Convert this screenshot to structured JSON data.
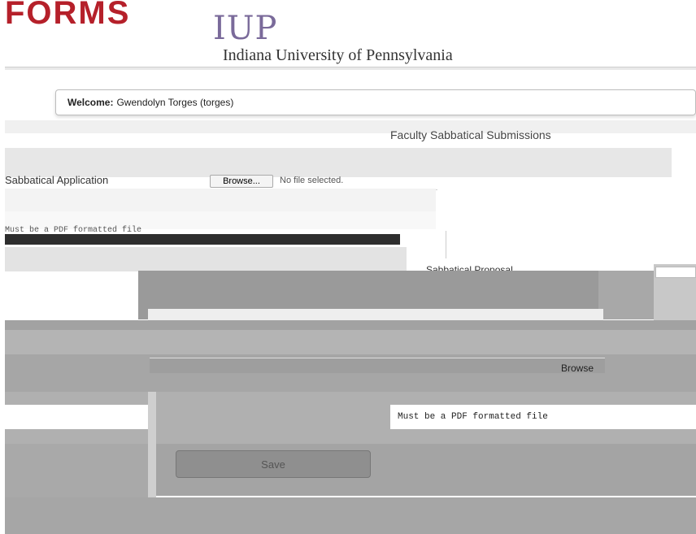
{
  "header": {
    "forms_logo": "FORMS",
    "iup_logo": "IUP",
    "university": "Indiana University of Pennsylvania"
  },
  "welcome": {
    "label": "Welcome:",
    "user": "Gwendolyn Torges (torges)"
  },
  "page": {
    "title": "Faculty Sabbatical Submissions"
  },
  "form": {
    "application_label": "Sabbatical Application",
    "browse_small": "Browse...",
    "no_file": "No file selected.",
    "pdf_hint": "Must be a PDF formatted file",
    "proposal_label": "Sabbatical Proposal",
    "browse_label": "Browse",
    "pdf_hint_bottom": "Must be a PDF formatted file",
    "save_label": "Save"
  }
}
